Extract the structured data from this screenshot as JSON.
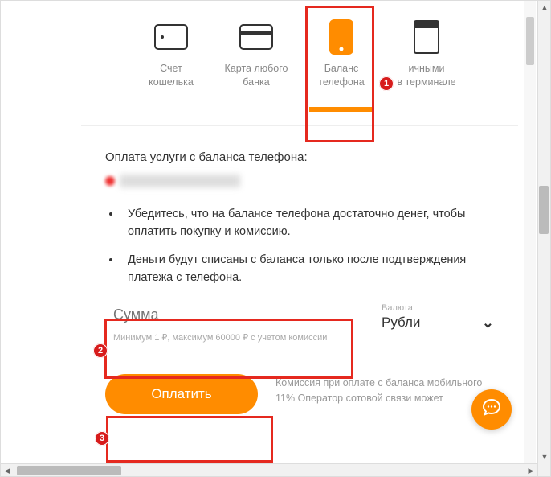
{
  "tabs": [
    {
      "label": "Счет\nкошелька",
      "active": false
    },
    {
      "label": "Карта любого\nбанка",
      "active": false
    },
    {
      "label": "Баланс\nтелефона",
      "active": true
    },
    {
      "label": "ичными\nв терминале",
      "active": false
    }
  ],
  "section": {
    "title": "Оплата услуги с баланса телефона:",
    "bullets": [
      "Убедитесь, что на балансе телефона достаточно денег, чтобы оплатить покупку и комиссию.",
      "Деньги будут списаны с баланса только после подтверждения платежа с телефона."
    ]
  },
  "form": {
    "amount_placeholder": "Сумма",
    "amount_hint": "Минимум 1 ₽, максимум 60000 ₽ с учетом комиссии",
    "currency_label": "Валюта",
    "currency_value": "Рубли"
  },
  "action": {
    "pay_label": "Оплатить",
    "commission_text": "Комиссия при оплате с баланса мобильного 11%\nОператор сотовой связи может"
  },
  "annotations": {
    "n1": "1",
    "n2": "2",
    "n3": "3"
  }
}
